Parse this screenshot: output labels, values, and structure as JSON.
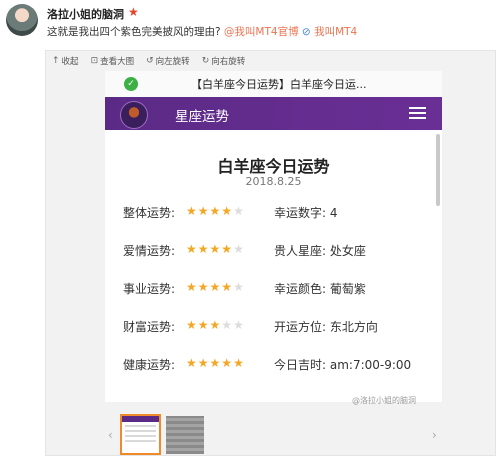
{
  "post": {
    "username": "洛拉小姐的脑洞",
    "text_main": "这就是我出四个紫色完美披风的理由?",
    "mention1": "@我叫MT4官博",
    "mention2": "我叫MT4",
    "verified_icon": "star-icon"
  },
  "toolbar": {
    "collapse_label": "收起",
    "view_large_label": "查看大图",
    "rotate_left_label": "向左旋转",
    "rotate_right_label": "向右旋转"
  },
  "browser": {
    "title": "【白羊座今日运势】白羊座今日运..."
  },
  "app": {
    "title": "星座运势"
  },
  "fortune": {
    "title": "白羊座今日运势",
    "date": "2018.8.25",
    "rows": [
      {
        "label": "整体运势:",
        "stars": 4,
        "right": "幸运数字: 4"
      },
      {
        "label": "爱情运势:",
        "stars": 4,
        "right": "贵人星座: 处女座"
      },
      {
        "label": "事业运势:",
        "stars": 4,
        "right": "幸运颜色: 葡萄紫"
      },
      {
        "label": "财富运势:",
        "stars": 3,
        "right": "开运方位: 东北方向"
      },
      {
        "label": "健康运势:",
        "stars": 5,
        "right": "今日吉时: am:7:00-9:00"
      }
    ],
    "max_stars": 5
  },
  "watermark": "@洛拉小姐的脑洞",
  "colors": {
    "header_purple": "#5b2a86",
    "star_on": "#f5a623",
    "accent_orange": "#f08a28",
    "mention": "#eb7350"
  }
}
